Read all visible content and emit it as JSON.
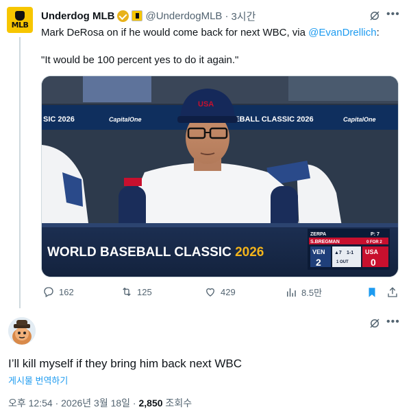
{
  "tweet": {
    "display_name": "Underdog MLB",
    "avatar_label": "MLB",
    "handle": "@UnderdogMLB",
    "dot": "·",
    "time": "3시간",
    "text_prefix": "Mark DeRosa on if he would come back for next WBC, via ",
    "mention": "@EvanDrellich",
    "text_suffix": ":",
    "quote": "\"It would be 100 percent yes to do it again.\"",
    "media": {
      "dugout_text": "WORLD BASEBALL CLASSIC 2026",
      "banner_left": "SIC 2026",
      "banner_sponsor": "CapitalOne",
      "banner_right": "ASEBALL CLASSIC 2026",
      "cap_logo": "USA",
      "scorebug": {
        "pitcher": "ZERPA",
        "pitch_count": "P: 7",
        "batter": "S.BREGMAN",
        "batter_stats": "0 FOR 2",
        "away_team": "VEN",
        "away_score": "2",
        "home_team": "USA",
        "home_score": "0",
        "inning": "▲7",
        "count": "1-1",
        "outs": "1 OUT"
      }
    },
    "actions": {
      "replies": "162",
      "retweets": "125",
      "likes": "429",
      "views": "8.5만"
    }
  },
  "reply": {
    "text": "I’ll kill myself if they bring him back next WBC",
    "translate": "게시물 번역하기",
    "timestamp": "오후 12:54 · 2026년 3월 18일 · ",
    "views_count": "2,850",
    "views_label": " 조회수"
  },
  "colors": {
    "accent": "#1d9bf0",
    "text": "#0f1419",
    "secondary": "#536471",
    "verified_gold": "#e8b21b",
    "brand_yellow": "#f7c600"
  }
}
